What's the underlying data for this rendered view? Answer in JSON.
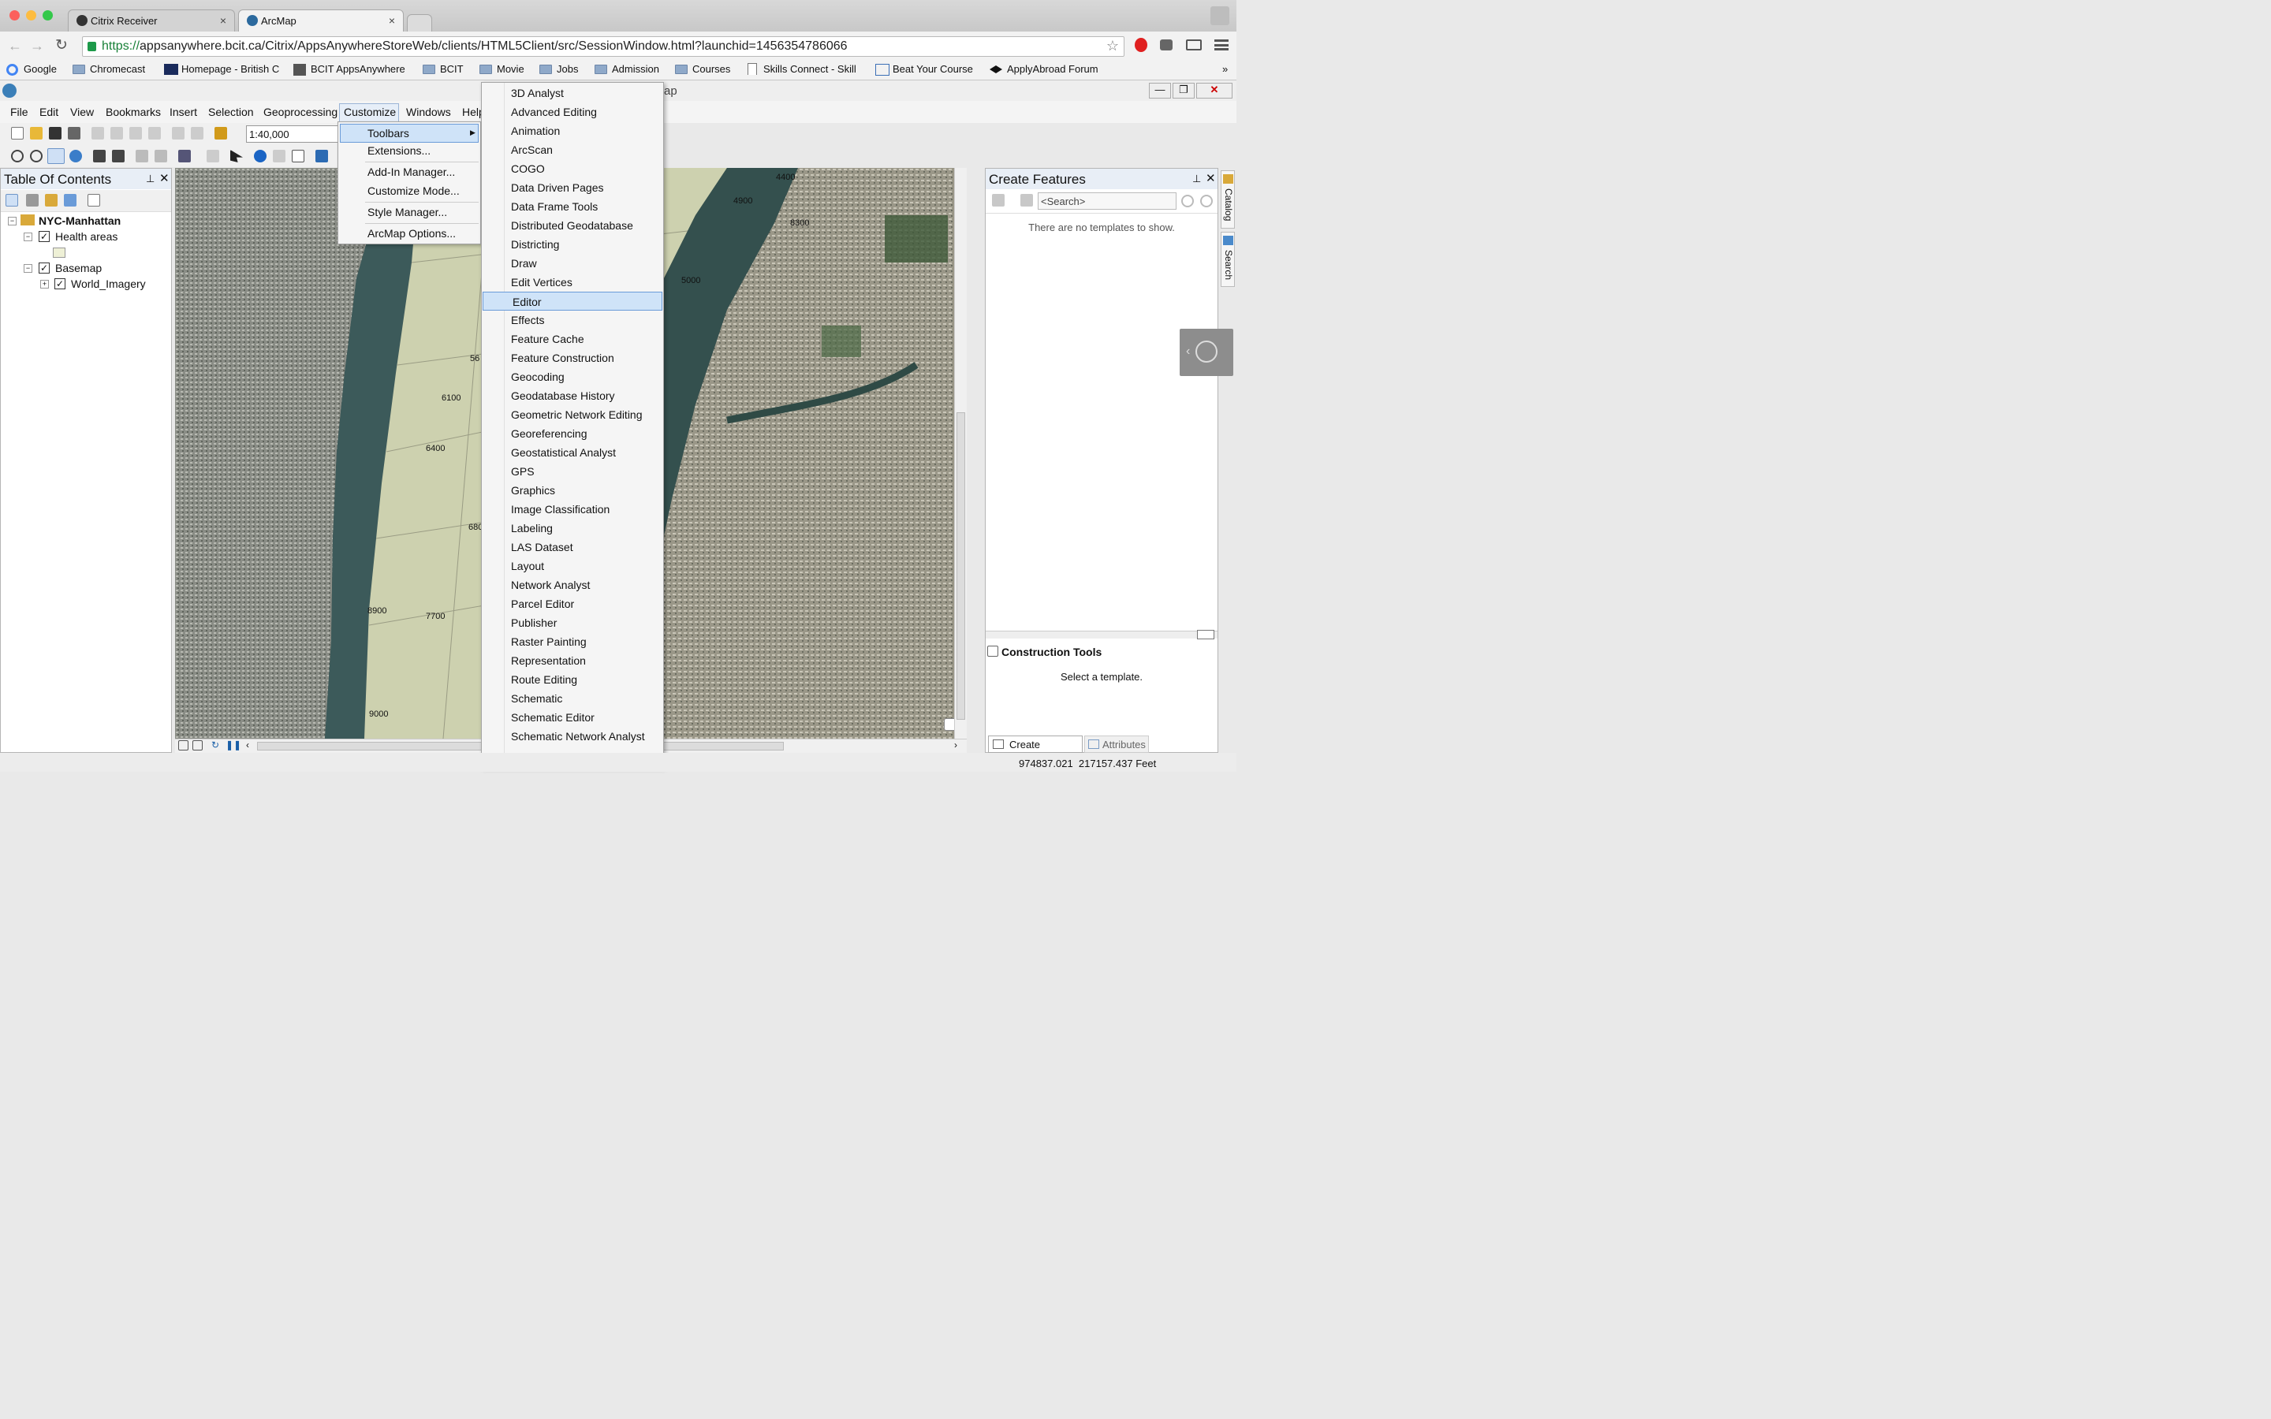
{
  "browser": {
    "tabs": [
      {
        "label": "Citrix Receiver",
        "close": "×"
      },
      {
        "label": "ArcMap",
        "close": "×"
      }
    ],
    "url_scheme": "https://",
    "url_rest": "appsanywhere.bcit.ca/Citrix/AppsAnywhereStoreWeb/clients/HTML5Client/src/SessionWindow.html?launchid=1456354786066",
    "bookmarks": [
      "Google",
      "Chromecast",
      "Homepage - British C",
      "BCIT AppsAnywhere",
      "BCIT",
      "Movie",
      "Jobs",
      "Admission",
      "Courses",
      "Skills Connect - Skill",
      "Beat Your Course",
      "ApplyAbroad Forum"
    ],
    "bookmark_more": "»"
  },
  "app": {
    "title_fragment": "ap",
    "menus": [
      "File",
      "Edit",
      "View",
      "Bookmarks",
      "Insert",
      "Selection",
      "Geoprocessing",
      "Customize",
      "Windows",
      "Help"
    ],
    "scale_value": "1:40,000"
  },
  "customize_menu": {
    "items": [
      "Toolbars",
      "Extensions...",
      "Add-In Manager...",
      "Customize Mode...",
      "Style Manager...",
      "ArcMap Options..."
    ],
    "submenu_arrow": "▶"
  },
  "toolbars_menu": {
    "items": [
      "3D Analyst",
      "Advanced Editing",
      "Animation",
      "ArcScan",
      "COGO",
      "Data Driven Pages",
      "Data Frame Tools",
      "Distributed Geodatabase",
      "Districting",
      "Draw",
      "Edit Vertices",
      "Editor",
      "Effects",
      "Feature Cache",
      "Feature Construction",
      "Geocoding",
      "Geodatabase History",
      "Geometric Network Editing",
      "Georeferencing",
      "Geostatistical Analyst",
      "GPS",
      "Graphics",
      "Image Classification",
      "Labeling",
      "LAS Dataset",
      "Layout",
      "Network Analyst",
      "Parcel Editor",
      "Publisher",
      "Raster Painting",
      "Representation",
      "Route Editing",
      "Schematic",
      "Schematic Editor",
      "Schematic Network Analyst"
    ],
    "highlighted": "Editor",
    "more_arrow": "▾"
  },
  "toc": {
    "title": "Table Of Contents",
    "tree": {
      "root": "NYC-Manhattan",
      "layer1": "Health areas",
      "layer2": "Basemap",
      "layer3": "World_Imagery"
    }
  },
  "map": {
    "labels": [
      "4400",
      "4900",
      "8300",
      "5000",
      "56",
      "6100",
      "6400",
      "680",
      "8900",
      "7700",
      "9000"
    ]
  },
  "create_features": {
    "title": "Create Features",
    "search_placeholder": "<Search>",
    "empty_msg": "There are no templates to show.",
    "construction_title": "Construction Tools",
    "construction_msg": "Select a template.",
    "tabs": [
      "Create Features",
      "Attributes"
    ],
    "side_tabs": [
      "Catalog",
      "Search"
    ]
  },
  "status": {
    "coords": "974837.021  217157.437 Feet"
  },
  "colors": {
    "menu_highlight": "#cfe3f8",
    "menu_highlight_border": "#6a9bd8",
    "parcel_fill": "#d9dcb8"
  }
}
